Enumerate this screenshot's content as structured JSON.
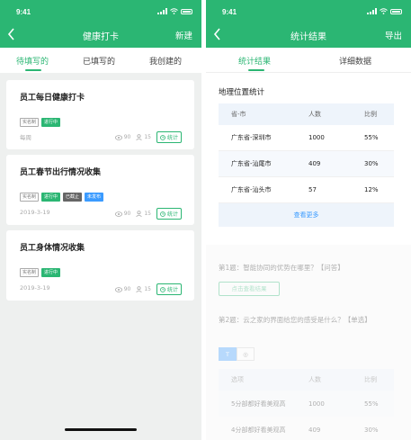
{
  "left": {
    "status": {
      "time": "9:41"
    },
    "appbar": {
      "title": "健康打卡",
      "action": "新建"
    },
    "tabs": [
      {
        "label": "待填写的"
      },
      {
        "label": "已填写的"
      },
      {
        "label": "我创建的"
      }
    ],
    "cards": [
      {
        "title": "员工每日健康打卡",
        "tags": [
          "实名制",
          "进行中"
        ],
        "meta": "每周",
        "views": "90",
        "people": "15",
        "stats_label": "统计"
      },
      {
        "title": "员工春节出行情况收集",
        "tags": [
          "实名制",
          "进行中",
          "已截止",
          "未发布"
        ],
        "meta": "2019-3-19",
        "views": "90",
        "people": "15",
        "stats_label": "统计"
      },
      {
        "title": "员工身体情况收集",
        "tags": [
          "实名制",
          "进行中"
        ],
        "meta": "2019-3-19",
        "views": "90",
        "people": "15",
        "stats_label": "统计"
      }
    ]
  },
  "right": {
    "status": {
      "time": "9:41"
    },
    "appbar": {
      "title": "统计结果",
      "action": "导出"
    },
    "tabs": [
      {
        "label": "统计结果"
      },
      {
        "label": "详细数据"
      }
    ],
    "section_title": "地理位置统计",
    "table": {
      "headers": [
        "省-市",
        "人数",
        "比例"
      ],
      "rows": [
        [
          "广东省-深圳市",
          "1000",
          "55%"
        ],
        [
          "广东省-汕尾市",
          "409",
          "30%"
        ],
        [
          "广东省-汕头市",
          "57",
          "12%"
        ]
      ],
      "more": "查看更多"
    },
    "q1": {
      "text": "第1题：智能协同的优势在哪里？【问答】",
      "button": "点击查看结果"
    },
    "q2": {
      "text": "第2题：云之家的界面给您的感受是什么？【单选】",
      "segments": [
        "T",
        "◎"
      ],
      "headers": [
        "选项",
        "人数",
        "比例"
      ],
      "rows": [
        [
          "5分部都好看美观高",
          "1000",
          "55%"
        ],
        [
          "4分部都好看美观高",
          "409",
          "30%"
        ]
      ]
    }
  },
  "colors": {
    "brand": "#2bb673",
    "link": "#3b9bff"
  }
}
